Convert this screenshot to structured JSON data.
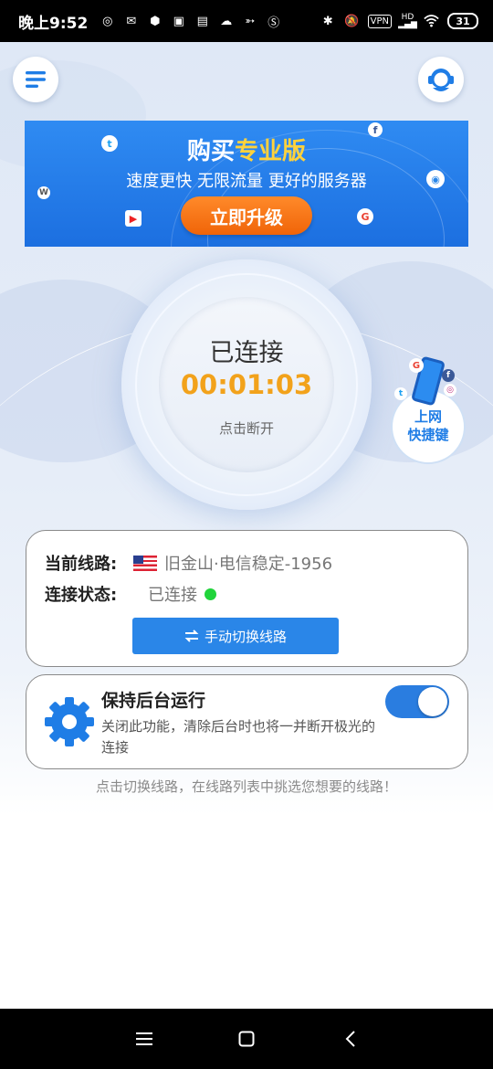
{
  "status_bar": {
    "time": "晚上9:52",
    "vpn_badge": "VPN",
    "hd_badge": "HD",
    "battery": "31"
  },
  "header": {
    "menu_icon": "menu-icon",
    "support_icon": "customer-service-icon"
  },
  "banner": {
    "title_prefix": "购买",
    "title_highlight": "专业版",
    "subtitle": "速度更快 无限流量 更好的服务器",
    "cta_label": "立即升级",
    "highlight_color": "#ffd23c"
  },
  "connection": {
    "status": "已连接",
    "elapsed": "00:01:03",
    "hint": "点击断开",
    "time_color": "#f2a21b"
  },
  "shortcut": {
    "line1": "上网",
    "line2": "快捷键"
  },
  "route_card": {
    "route_key": "当前线路:",
    "route_value": "旧金山·电信稳定-1956",
    "route_flag": "us-flag-icon",
    "state_key": "连接状态:",
    "state_value": "已连接",
    "state_color": "#21d43b",
    "switch_label": "手动切换线路"
  },
  "keep_alive": {
    "title": "保持后台运行",
    "description": "关闭此功能，清除后台时也将一并断开极光的连接",
    "enabled": true
  },
  "footer_tip": "点击切换线路，在线路列表中挑选您想要的线路！"
}
